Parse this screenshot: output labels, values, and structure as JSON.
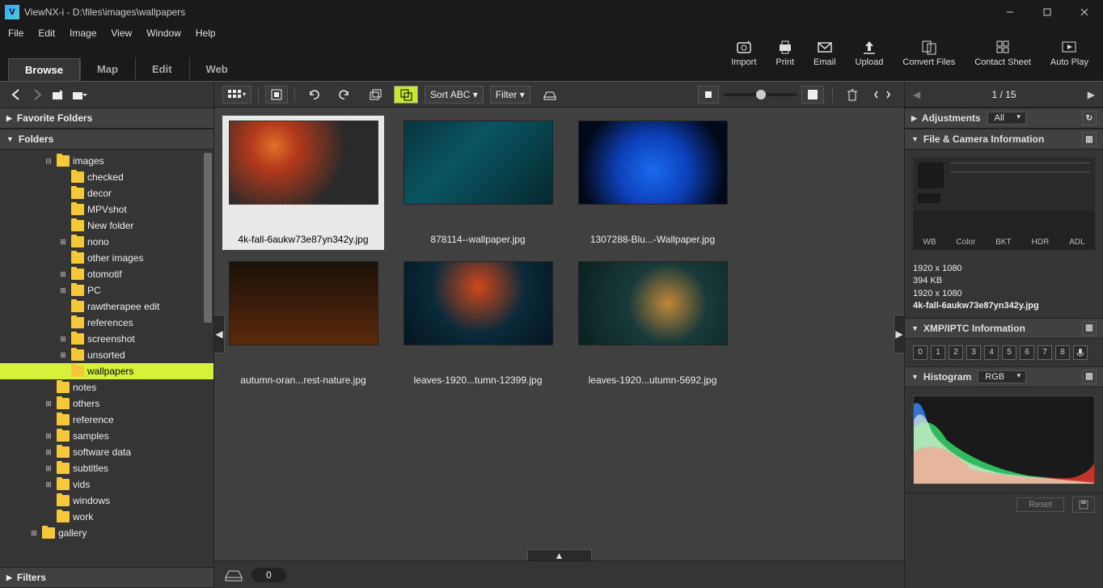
{
  "window": {
    "app": "ViewNX-i",
    "path": "D:\\files\\images\\wallpapers",
    "title": "ViewNX-i - D:\\files\\images\\wallpapers"
  },
  "menu": [
    "File",
    "Edit",
    "Image",
    "View",
    "Window",
    "Help"
  ],
  "tabs": [
    "Browse",
    "Map",
    "Edit",
    "Web"
  ],
  "toolbar": [
    {
      "label": "Import"
    },
    {
      "label": "Print"
    },
    {
      "label": "Email"
    },
    {
      "label": "Upload"
    },
    {
      "label": "Convert Files"
    },
    {
      "label": "Contact Sheet"
    },
    {
      "label": "Auto Play"
    }
  ],
  "panels": {
    "favorites": "Favorite Folders",
    "folders": "Folders",
    "filters": "Filters"
  },
  "tree": [
    {
      "indent": 3,
      "exp": "⊟",
      "name": "images",
      "sel": false
    },
    {
      "indent": 4,
      "exp": "",
      "name": "checked"
    },
    {
      "indent": 4,
      "exp": "",
      "name": "decor"
    },
    {
      "indent": 4,
      "exp": "",
      "name": "MPVshot"
    },
    {
      "indent": 4,
      "exp": "",
      "name": "New folder"
    },
    {
      "indent": 4,
      "exp": "⊞",
      "name": "nono"
    },
    {
      "indent": 4,
      "exp": "",
      "name": "other images"
    },
    {
      "indent": 4,
      "exp": "⊞",
      "name": "otomotif"
    },
    {
      "indent": 4,
      "exp": "⊞",
      "name": "PC"
    },
    {
      "indent": 4,
      "exp": "",
      "name": "rawtherapee edit"
    },
    {
      "indent": 4,
      "exp": "",
      "name": "references"
    },
    {
      "indent": 4,
      "exp": "⊞",
      "name": "screenshot"
    },
    {
      "indent": 4,
      "exp": "⊞",
      "name": "unsorted"
    },
    {
      "indent": 4,
      "exp": "",
      "name": "wallpapers",
      "sel": true
    },
    {
      "indent": 3,
      "exp": "",
      "name": "notes"
    },
    {
      "indent": 3,
      "exp": "⊞",
      "name": "others"
    },
    {
      "indent": 3,
      "exp": "",
      "name": "reference"
    },
    {
      "indent": 3,
      "exp": "⊞",
      "name": "samples"
    },
    {
      "indent": 3,
      "exp": "⊞",
      "name": "software data"
    },
    {
      "indent": 3,
      "exp": "⊞",
      "name": "subtitles"
    },
    {
      "indent": 3,
      "exp": "⊞",
      "name": "vids"
    },
    {
      "indent": 3,
      "exp": "",
      "name": "windows"
    },
    {
      "indent": 3,
      "exp": "",
      "name": "work"
    },
    {
      "indent": 2,
      "exp": "⊞",
      "name": "gallery"
    }
  ],
  "ctoolbar": {
    "sort": "Sort ABC ▾",
    "filter": "Filter ▾"
  },
  "thumbs": [
    {
      "name": "4k-fall-6aukw73e87yn342y.jpg",
      "sel": true,
      "bg": "radial-gradient(circle at 30% 30%, #e0702a 0%, #b3391b 20%, #2a2a2a 60%), linear-gradient(45deg,#3a3a3a,#1a1a1a)"
    },
    {
      "name": "878114--wallpaper.jpg",
      "bg": "linear-gradient(135deg,#07343f,#0a5560 40%,#062830)"
    },
    {
      "name": "1307288-Blu...-Wallpaper.jpg",
      "bg": "radial-gradient(circle at 50% 60%, #1a6bf0 0%, #0d3fb8 40%, #020a1a 80%)"
    },
    {
      "name": "autumn-oran...rest-nature.jpg",
      "bg": "linear-gradient(180deg,#1a1208 0%,#3a1c0a 50%,#5a2a0a 100%)"
    },
    {
      "name": "leaves-1920...tumn-12399.jpg",
      "bg": "radial-gradient(circle at 50% 30%, #d0471a 0%, #0a2a3a 50%, #051520 100%)"
    },
    {
      "name": "leaves-1920...utumn-5692.jpg",
      "bg": "radial-gradient(circle at 60% 50%, #c08838 0%, #1a3a3a 40%, #0a2020 100%)"
    }
  ],
  "tray_count": "0",
  "nav": {
    "page": "1 / 15"
  },
  "adjustments": {
    "label": "Adjustments",
    "mode": "All"
  },
  "camera": {
    "header": "File & Camera Information",
    "tags": [
      "WB",
      "Color",
      "BKT",
      "HDR",
      "ADL"
    ],
    "res1": "1920 x 1080",
    "size": "394 KB",
    "res2": "1920 x 1080",
    "file": "4k-fall-6aukw73e87yn342y.jpg"
  },
  "xmp": {
    "header": "XMP/IPTC Information",
    "ratings": [
      "0",
      "1",
      "2",
      "3",
      "4",
      "5",
      "6",
      "7",
      "8"
    ]
  },
  "histogram": {
    "header": "Histogram",
    "mode": "RGB"
  },
  "footer": {
    "reset": "Reset"
  }
}
